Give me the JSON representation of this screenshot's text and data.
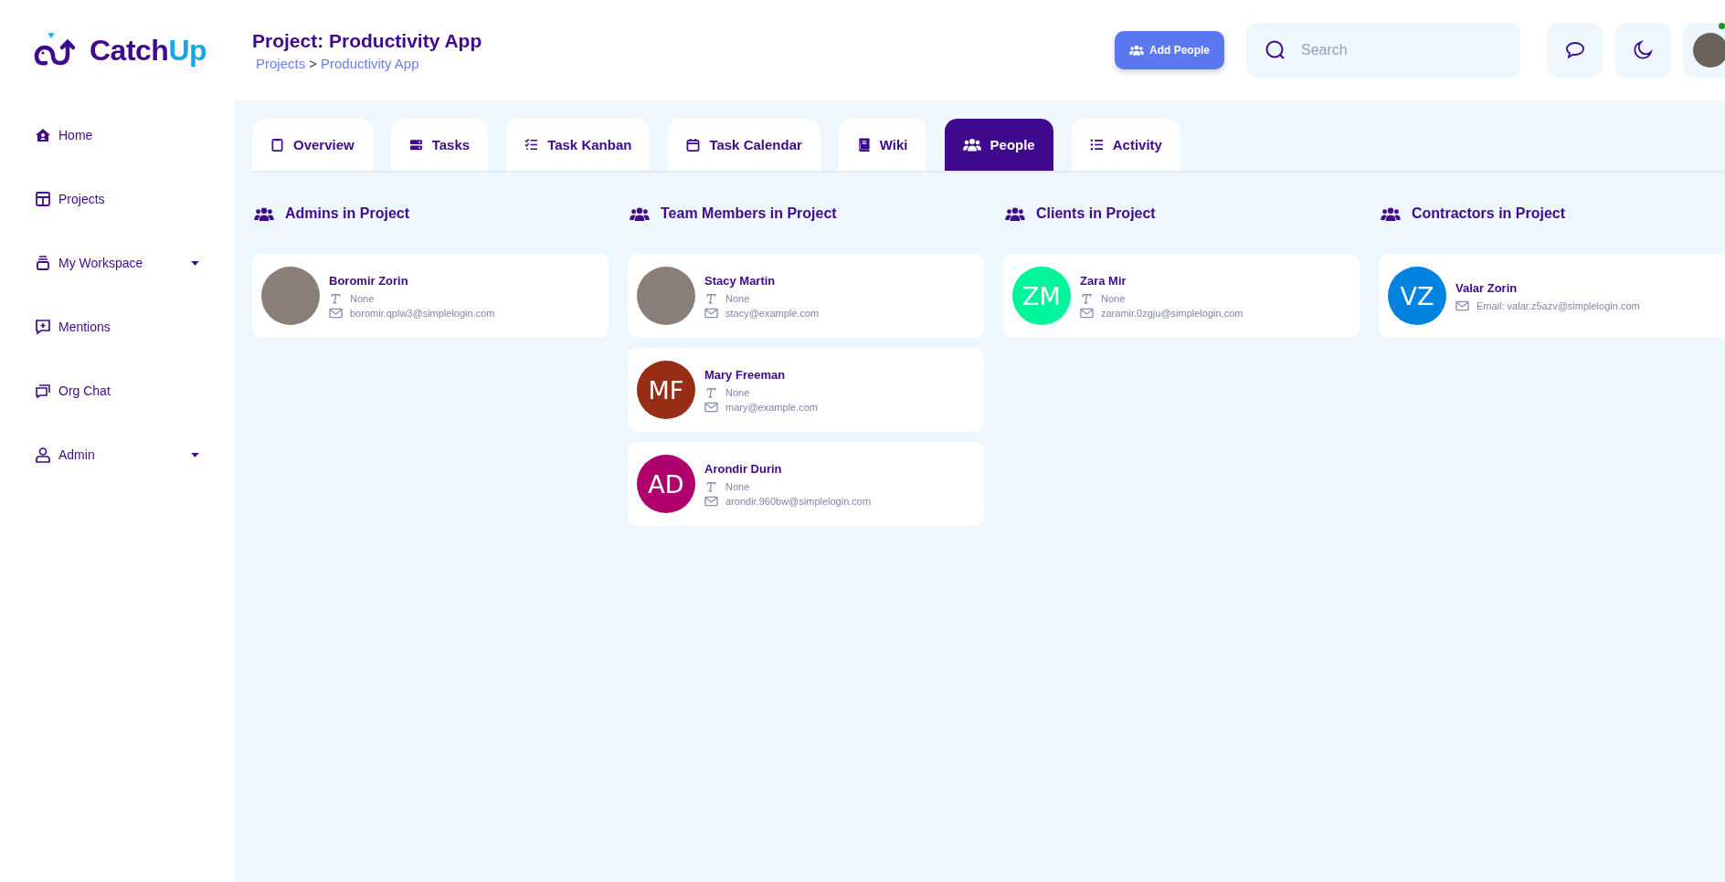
{
  "logo": {
    "text_main": "Catch",
    "text_accent": "Up"
  },
  "header": {
    "title": "Project: Productivity App",
    "breadcrumb": [
      "Projects",
      "Productivity App"
    ],
    "separator": ">",
    "add_button": "Add People",
    "search": {
      "placeholder": "Search"
    },
    "user": {
      "online": true
    }
  },
  "sidebar": {
    "items": [
      {
        "label": "Home",
        "dropdown": false
      },
      {
        "label": "Projects",
        "dropdown": false
      },
      {
        "label": "My Workspace",
        "dropdown": true
      },
      {
        "label": "Mentions",
        "dropdown": false
      },
      {
        "label": "Org Chat",
        "dropdown": false
      },
      {
        "label": "Admin",
        "dropdown": true
      }
    ]
  },
  "tabs": [
    {
      "label": "Overview",
      "selected": false
    },
    {
      "label": "Tasks",
      "selected": false
    },
    {
      "label": "Task Kanban",
      "selected": false
    },
    {
      "label": "Task Calendar",
      "selected": false
    },
    {
      "label": "Wiki",
      "selected": false
    },
    {
      "label": "People",
      "selected": true
    },
    {
      "label": "Activity",
      "selected": false
    }
  ],
  "groups": [
    {
      "title": "Admins in Project",
      "people": [
        {
          "name": "Boromir Zorin",
          "kind": "photo",
          "role": "None",
          "email": "boromir.qplw3@simplelogin.com"
        }
      ]
    },
    {
      "title": "Team Members in Project",
      "people": [
        {
          "name": "Stacy Martin",
          "kind": "photo",
          "role": "None",
          "email": "stacy@example.com"
        },
        {
          "name": "Mary Freeman",
          "kind": "initials",
          "initials": "MF",
          "color": "#962d14",
          "role": "None",
          "email": "mary@example.com"
        },
        {
          "name": "Arondir Durin",
          "kind": "initials",
          "initials": "AD",
          "color": "#b0006e",
          "role": "None",
          "email": "arondir.960bw@simplelogin.com"
        }
      ]
    },
    {
      "title": "Clients in Project",
      "people": [
        {
          "name": "Zara Mir",
          "kind": "initials",
          "initials": "ZM",
          "color": "#00f59b",
          "role": "None",
          "email": "zaramir.0zgju@simplelogin.com"
        }
      ]
    },
    {
      "title": "Contractors in Project",
      "people": [
        {
          "name": "Valar Zorin",
          "kind": "initials",
          "initials": "VZ",
          "color": "#0084e0",
          "email": "Email: valar.z5azv@simplelogin.com"
        }
      ]
    }
  ]
}
